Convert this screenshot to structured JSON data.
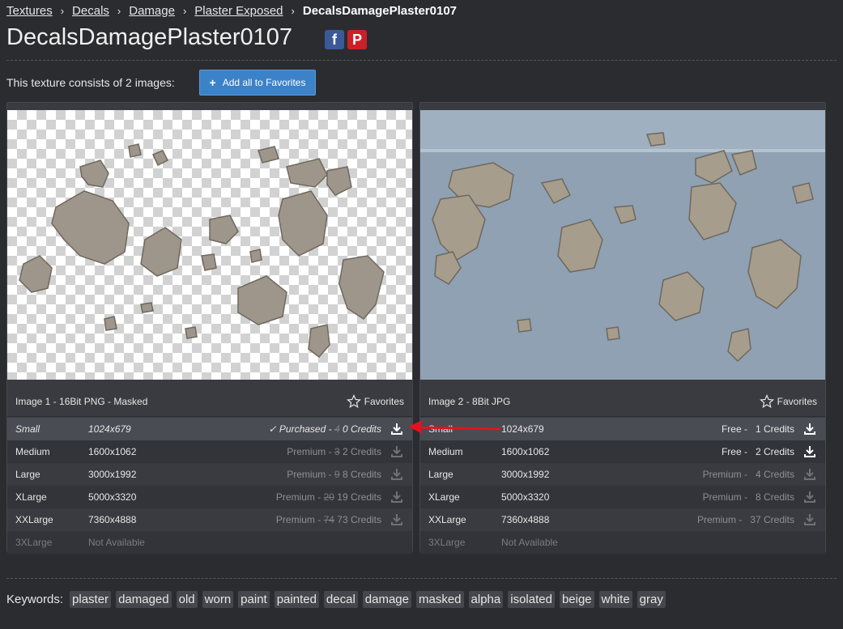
{
  "breadcrumb": {
    "items": [
      "Textures",
      "Decals",
      "Damage",
      "Plaster Exposed"
    ],
    "separator": "›",
    "current": "DecalsDamagePlaster0107"
  },
  "page_title": "DecalsDamagePlaster0107",
  "social": {
    "facebook": "f",
    "pinterest": "P"
  },
  "consists_text": "This texture consists of 2 images:",
  "add_all_button": {
    "icon": "+",
    "label": "Add all to Favorites"
  },
  "favorites_label": "Favorites",
  "images": [
    {
      "header": "Image 1 - 16Bit PNG - Masked",
      "preview": "checkerboard-transparent",
      "rows": [
        {
          "size": "Small",
          "res": "1024x679",
          "tier": "Purchased -",
          "old": "4",
          "credits": "0 Credits",
          "check": "✓"
        },
        {
          "size": "Medium",
          "res": "1600x1062",
          "tier": "Premium -",
          "old": "3",
          "credits": "2 Credits"
        },
        {
          "size": "Large",
          "res": "3000x1992",
          "tier": "Premium -",
          "old": "9",
          "credits": "8 Credits"
        },
        {
          "size": "XLarge",
          "res": "5000x3320",
          "tier": "Premium -",
          "old": "20",
          "credits": "19 Credits"
        },
        {
          "size": "XXLarge",
          "res": "7360x4888",
          "tier": "Premium -",
          "old": "74",
          "credits": "73 Credits"
        },
        {
          "size": "3XLarge",
          "res": "Not Available"
        }
      ]
    },
    {
      "header": "Image 2 - 8Bit JPG",
      "preview": "blue-plaster-wall",
      "rows": [
        {
          "size": "Small",
          "res": "1024x679",
          "tier": "Free -",
          "credits": "1 Credits"
        },
        {
          "size": "Medium",
          "res": "1600x1062",
          "tier": "Free -",
          "credits": "2 Credits"
        },
        {
          "size": "Large",
          "res": "3000x1992",
          "tier": "Premium -",
          "credits": "4 Credits"
        },
        {
          "size": "XLarge",
          "res": "5000x3320",
          "tier": "Premium -",
          "credits": "8 Credits"
        },
        {
          "size": "XXLarge",
          "res": "7360x4888",
          "tier": "Premium -",
          "credits": "37 Credits"
        },
        {
          "size": "3XLarge",
          "res": "Not Available"
        }
      ]
    }
  ],
  "keywords_label": "Keywords:",
  "keywords": [
    "plaster",
    "damaged",
    "old",
    "worn",
    "paint",
    "painted",
    "decal",
    "damage",
    "masked",
    "alpha",
    "isolated",
    "beige",
    "white",
    "gray"
  ],
  "colors": {
    "background": "#2b2c30",
    "accent_button": "#3c82c8",
    "arrow": "#e0141e",
    "facebook": "#3b5998",
    "pinterest": "#cb2027"
  }
}
